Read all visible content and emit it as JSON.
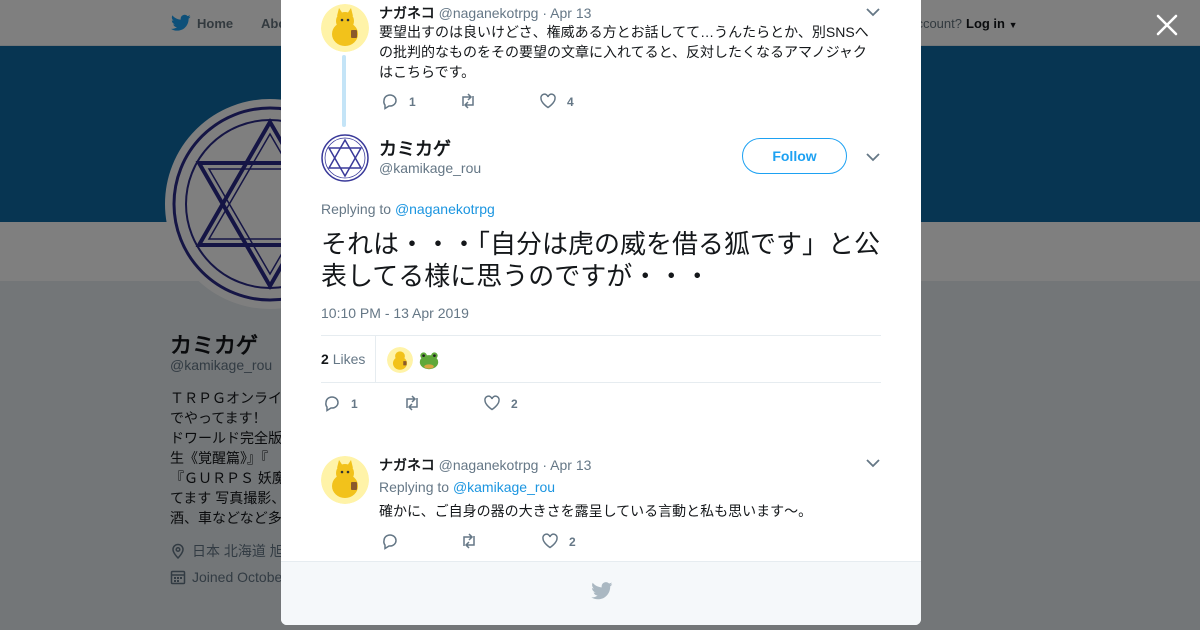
{
  "topbar": {
    "home_label": "Home",
    "about_label": "Abo",
    "account_prompt": "ccount?",
    "login_label": "Log in"
  },
  "profile": {
    "name": "カミカゲ",
    "handle": "@kamikage_rou",
    "bio_lines": [
      "ＴＲＰＧオンライ",
      "でやってます！",
      "ドワールド完全版",
      "生《覚醒篇》』『",
      "『ＧＵＲＰＳ 妖魔",
      "てます 写真撮影、",
      "酒、車などなど多"
    ],
    "location": "日本 北海道 旭",
    "joined": "Joined Octobe"
  },
  "modal": {
    "parent_tweet": {
      "name": "ナガネコ",
      "handle": "@naganekotrpg",
      "date": "· Apr 13",
      "text": "要望出すのは良いけどさ、権威ある方とお話してて…うんたらとか、別SNSへの批判的なものをその要望の文章に入れてると、反対したくなるアマノジャクはこちらです。",
      "replies": "1",
      "retweets": "",
      "likes": "4"
    },
    "main_tweet": {
      "name": "カミカゲ",
      "handle": "@kamikage_rou",
      "follow_label": "Follow",
      "replying_prefix": "Replying to",
      "replying_to": "@naganekotrpg",
      "text": "それは・・・「自分は虎の威を借る狐です」と公表してる様に思うのですが・・・",
      "timestamp": "10:10 PM - 13 Apr 2019",
      "like_count": "2",
      "like_label": "Likes",
      "replies": "1",
      "retweets": "",
      "likes": "2"
    },
    "reply_tweet": {
      "name": "ナガネコ",
      "handle": "@naganekotrpg",
      "date": "· Apr 13",
      "replying_prefix": "Replying to",
      "replying_to": "@kamikage_rou",
      "text": "確かに、ご自身の器の大きさを露呈している言動と私も思います～。",
      "replies": "",
      "retweets": "",
      "likes": "2"
    }
  },
  "colors": {
    "brand_blue": "#1da1f2",
    "link_blue": "#1b95e0",
    "banner": "#0f6aa5",
    "muted_text": "#657786"
  },
  "icons": [
    "twitter-bird-icon",
    "close-icon",
    "reply-icon",
    "retweet-icon",
    "heart-icon",
    "chevron-down-icon",
    "location-icon",
    "calendar-icon"
  ]
}
